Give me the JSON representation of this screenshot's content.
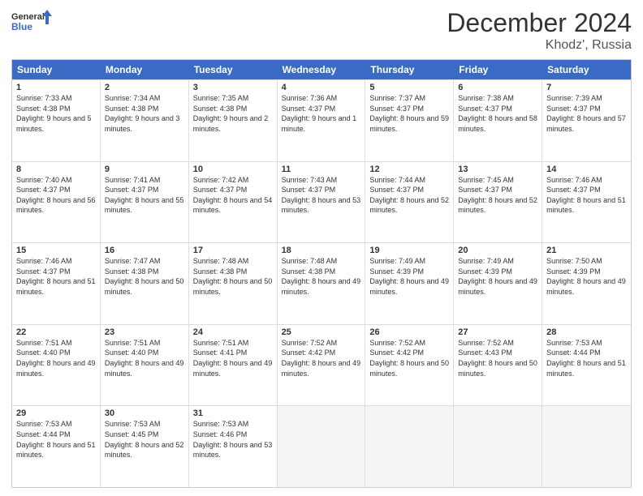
{
  "header": {
    "logo_line1": "General",
    "logo_line2": "Blue",
    "month": "December 2024",
    "location": "Khodz', Russia"
  },
  "days_of_week": [
    "Sunday",
    "Monday",
    "Tuesday",
    "Wednesday",
    "Thursday",
    "Friday",
    "Saturday"
  ],
  "weeks": [
    [
      {
        "day": 1,
        "sunrise": "7:33 AM",
        "sunset": "4:38 PM",
        "daylight": "9 hours and 5 minutes."
      },
      {
        "day": 2,
        "sunrise": "7:34 AM",
        "sunset": "4:38 PM",
        "daylight": "9 hours and 3 minutes."
      },
      {
        "day": 3,
        "sunrise": "7:35 AM",
        "sunset": "4:38 PM",
        "daylight": "9 hours and 2 minutes."
      },
      {
        "day": 4,
        "sunrise": "7:36 AM",
        "sunset": "4:37 PM",
        "daylight": "9 hours and 1 minute."
      },
      {
        "day": 5,
        "sunrise": "7:37 AM",
        "sunset": "4:37 PM",
        "daylight": "8 hours and 59 minutes."
      },
      {
        "day": 6,
        "sunrise": "7:38 AM",
        "sunset": "4:37 PM",
        "daylight": "8 hours and 58 minutes."
      },
      {
        "day": 7,
        "sunrise": "7:39 AM",
        "sunset": "4:37 PM",
        "daylight": "8 hours and 57 minutes."
      }
    ],
    [
      {
        "day": 8,
        "sunrise": "7:40 AM",
        "sunset": "4:37 PM",
        "daylight": "8 hours and 56 minutes."
      },
      {
        "day": 9,
        "sunrise": "7:41 AM",
        "sunset": "4:37 PM",
        "daylight": "8 hours and 55 minutes."
      },
      {
        "day": 10,
        "sunrise": "7:42 AM",
        "sunset": "4:37 PM",
        "daylight": "8 hours and 54 minutes."
      },
      {
        "day": 11,
        "sunrise": "7:43 AM",
        "sunset": "4:37 PM",
        "daylight": "8 hours and 53 minutes."
      },
      {
        "day": 12,
        "sunrise": "7:44 AM",
        "sunset": "4:37 PM",
        "daylight": "8 hours and 52 minutes."
      },
      {
        "day": 13,
        "sunrise": "7:45 AM",
        "sunset": "4:37 PM",
        "daylight": "8 hours and 52 minutes."
      },
      {
        "day": 14,
        "sunrise": "7:46 AM",
        "sunset": "4:37 PM",
        "daylight": "8 hours and 51 minutes."
      }
    ],
    [
      {
        "day": 15,
        "sunrise": "7:46 AM",
        "sunset": "4:37 PM",
        "daylight": "8 hours and 51 minutes."
      },
      {
        "day": 16,
        "sunrise": "7:47 AM",
        "sunset": "4:38 PM",
        "daylight": "8 hours and 50 minutes."
      },
      {
        "day": 17,
        "sunrise": "7:48 AM",
        "sunset": "4:38 PM",
        "daylight": "8 hours and 50 minutes."
      },
      {
        "day": 18,
        "sunrise": "7:48 AM",
        "sunset": "4:38 PM",
        "daylight": "8 hours and 49 minutes."
      },
      {
        "day": 19,
        "sunrise": "7:49 AM",
        "sunset": "4:39 PM",
        "daylight": "8 hours and 49 minutes."
      },
      {
        "day": 20,
        "sunrise": "7:49 AM",
        "sunset": "4:39 PM",
        "daylight": "8 hours and 49 minutes."
      },
      {
        "day": 21,
        "sunrise": "7:50 AM",
        "sunset": "4:39 PM",
        "daylight": "8 hours and 49 minutes."
      }
    ],
    [
      {
        "day": 22,
        "sunrise": "7:51 AM",
        "sunset": "4:40 PM",
        "daylight": "8 hours and 49 minutes."
      },
      {
        "day": 23,
        "sunrise": "7:51 AM",
        "sunset": "4:40 PM",
        "daylight": "8 hours and 49 minutes."
      },
      {
        "day": 24,
        "sunrise": "7:51 AM",
        "sunset": "4:41 PM",
        "daylight": "8 hours and 49 minutes."
      },
      {
        "day": 25,
        "sunrise": "7:52 AM",
        "sunset": "4:42 PM",
        "daylight": "8 hours and 49 minutes."
      },
      {
        "day": 26,
        "sunrise": "7:52 AM",
        "sunset": "4:42 PM",
        "daylight": "8 hours and 50 minutes."
      },
      {
        "day": 27,
        "sunrise": "7:52 AM",
        "sunset": "4:43 PM",
        "daylight": "8 hours and 50 minutes."
      },
      {
        "day": 28,
        "sunrise": "7:53 AM",
        "sunset": "4:44 PM",
        "daylight": "8 hours and 51 minutes."
      }
    ],
    [
      {
        "day": 29,
        "sunrise": "7:53 AM",
        "sunset": "4:44 PM",
        "daylight": "8 hours and 51 minutes."
      },
      {
        "day": 30,
        "sunrise": "7:53 AM",
        "sunset": "4:45 PM",
        "daylight": "8 hours and 52 minutes."
      },
      {
        "day": 31,
        "sunrise": "7:53 AM",
        "sunset": "4:46 PM",
        "daylight": "8 hours and 53 minutes."
      },
      null,
      null,
      null,
      null
    ]
  ]
}
